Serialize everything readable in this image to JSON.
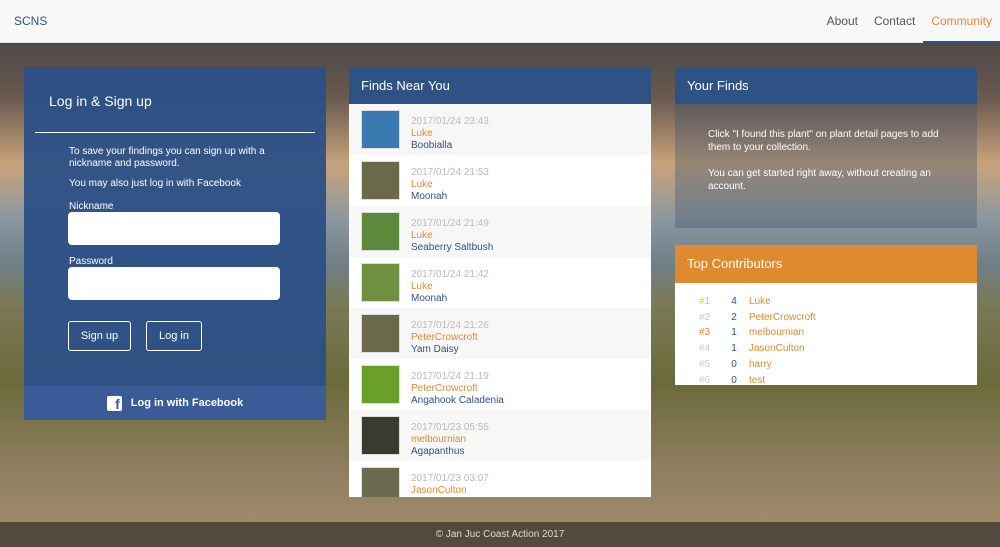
{
  "nav": {
    "brand": "SCNS",
    "links": [
      "About",
      "Contact",
      "Community"
    ],
    "active": "Community"
  },
  "login": {
    "title": "Log in & Sign up",
    "info1": "To save your findings you can sign up with a nickname and password.",
    "info2": "You may also just log in with Facebook",
    "nickname_label": "Nickname",
    "password_label": "Password",
    "signup": "Sign up",
    "login": "Log in",
    "facebook": "Log in with Facebook"
  },
  "finds": {
    "title": "Finds Near You",
    "items": [
      {
        "date": "2017/01/24 23:43",
        "user": "Luke",
        "plant": "Boobialla",
        "color": "#3a7ab0"
      },
      {
        "date": "2017/01/24 21:53",
        "user": "Luke",
        "plant": "Moonah",
        "color": "#6b6a48"
      },
      {
        "date": "2017/01/24 21:49",
        "user": "Luke",
        "plant": "Seaberry Saltbush",
        "color": "#5d8a3a"
      },
      {
        "date": "2017/01/24 21:42",
        "user": "Luke",
        "plant": "Moonah",
        "color": "#6f9040"
      },
      {
        "date": "2017/01/24 21:26",
        "user": "PeterCrowcroft",
        "plant": "Yam Daisy",
        "color": "#6a6a4a"
      },
      {
        "date": "2017/01/24 21:19",
        "user": "PeterCrowcroft",
        "plant": "Angahook Caladenia",
        "color": "#6aa02a"
      },
      {
        "date": "2017/01/23 05:55",
        "user": "melbournian",
        "plant": "Agapanthus",
        "color": "#3a3a30"
      },
      {
        "date": "2017/01/23 03:07",
        "user": "JasonCulton",
        "plant": "",
        "color": "#6a6a50"
      }
    ]
  },
  "your_finds": {
    "title": "Your Finds",
    "text1": "Click \"I found this plant\" on plant detail pages to add them to your collection.",
    "text2": "You can get started right away, without creating an account."
  },
  "top_contributors": {
    "title": "Top Contributors",
    "rows": [
      {
        "rank": "#1",
        "count": "4",
        "name": "Luke",
        "color": "#f5c518"
      },
      {
        "rank": "#2",
        "count": "2",
        "name": "PeterCrowcroft",
        "color": "#9ad8e0"
      },
      {
        "rank": "#3",
        "count": "1",
        "name": "melbournian",
        "color": "#d9863a"
      },
      {
        "rank": "#4",
        "count": "1",
        "name": "JasonCulton",
        "color": "#ccc"
      },
      {
        "rank": "#5",
        "count": "0",
        "name": "harry",
        "color": "#ccc"
      },
      {
        "rank": "#6",
        "count": "0",
        "name": "test",
        "color": "#ccc"
      }
    ]
  },
  "footer": "© Jan Juc Coast Action 2017"
}
